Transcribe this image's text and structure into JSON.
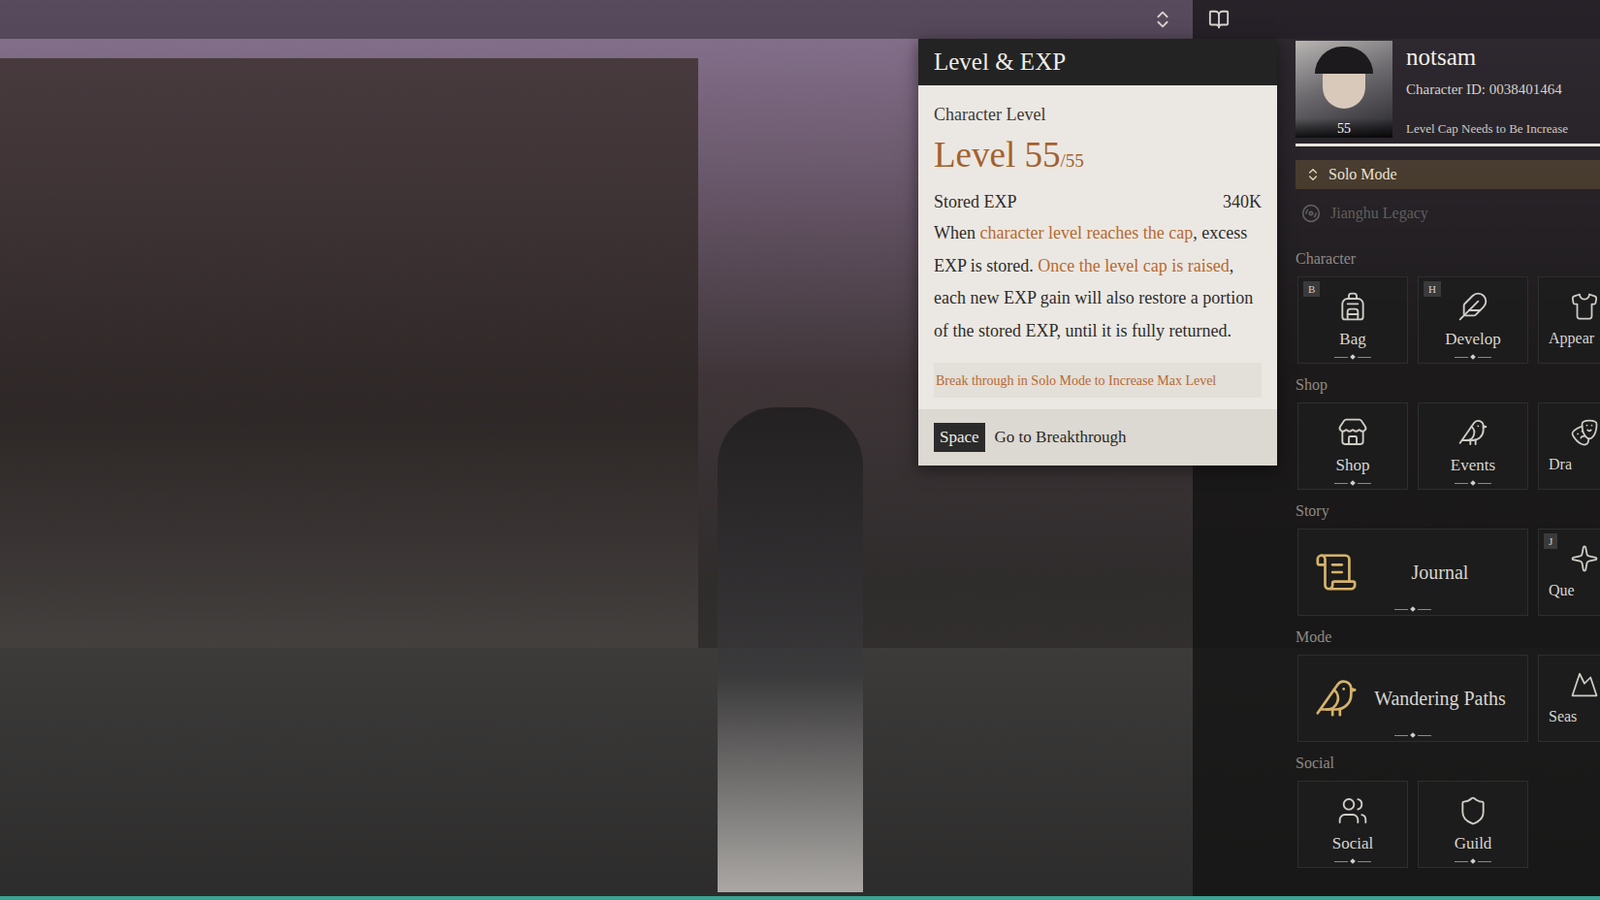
{
  "popup": {
    "title": "Level & EXP",
    "label": "Character Level",
    "level": "Level 55",
    "cap": "/55",
    "stored_label": "Stored EXP",
    "stored_value": "340K",
    "description": [
      {
        "text": "When ",
        "highlight": false
      },
      {
        "text": "character level reaches the cap",
        "highlight": true
      },
      {
        "text": ", excess EXP is stored. ",
        "highlight": false
      },
      {
        "text": "Once the level cap is raised",
        "highlight": true
      },
      {
        "text": ", each new EXP gain will also restore a portion of the stored EXP, until it is fully returned.",
        "highlight": false
      }
    ],
    "hint": "Break through in Solo Mode to Increase Max Level",
    "action": {
      "key": "Space",
      "label": "Go to Breakthrough"
    }
  },
  "profile": {
    "name": "notsam",
    "character_id": "Character ID: 0038401464",
    "level": "55",
    "notice": "Level Cap Needs to Be Increase"
  },
  "mode_button": {
    "label": "Solo Mode"
  },
  "legacy": {
    "label": "Jianghu Legacy",
    "disabled": true
  },
  "sections": [
    {
      "title": "Character",
      "items": [
        {
          "label": "Bag",
          "key": "B",
          "kind": "tile"
        },
        {
          "label": "Develop",
          "key": "H",
          "kind": "tile"
        },
        {
          "label": "Appear",
          "kind": "cut"
        }
      ]
    },
    {
      "title": "Shop",
      "items": [
        {
          "label": "Shop",
          "kind": "tile"
        },
        {
          "label": "Events",
          "kind": "tile"
        },
        {
          "label": "Dra",
          "kind": "cut"
        }
      ]
    },
    {
      "title": "Story",
      "items": [
        {
          "label": "Journal",
          "kind": "wide"
        },
        {
          "label": "Que",
          "key": "J",
          "kind": "cut"
        }
      ]
    },
    {
      "title": "Mode",
      "items": [
        {
          "label": "Wandering Paths",
          "kind": "wide"
        },
        {
          "label": "Seas",
          "kind": "cut"
        }
      ]
    },
    {
      "title": "Social",
      "items": [
        {
          "label": "Social",
          "kind": "tile"
        },
        {
          "label": "Guild",
          "kind": "tile"
        }
      ]
    }
  ]
}
